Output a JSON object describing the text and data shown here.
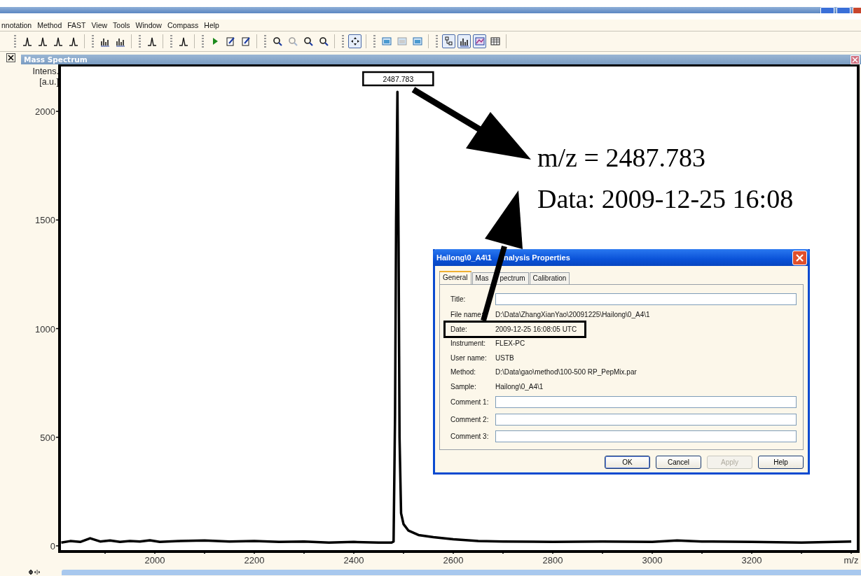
{
  "menu": [
    "nnotation",
    "Method",
    "FAST",
    "View",
    "Tools",
    "Window",
    "Compass",
    "Help"
  ],
  "toolbar": [
    {
      "pressed": false,
      "disabled": false
    },
    {
      "pressed": false,
      "disabled": false
    },
    {
      "pressed": false,
      "disabled": false
    },
    {
      "pressed": false,
      "disabled": false
    },
    {
      "pressed": false,
      "disabled": false
    },
    {
      "pressed": false,
      "disabled": false
    },
    {
      "pressed": false,
      "disabled": false
    },
    {
      "pressed": false,
      "disabled": false
    },
    {
      "pressed": false,
      "disabled": false
    },
    {
      "pressed": false,
      "disabled": false
    },
    {
      "pressed": false,
      "disabled": false
    },
    {
      "pressed": false,
      "disabled": false
    },
    {
      "pressed": false,
      "disabled": true
    },
    {
      "pressed": false,
      "disabled": false
    },
    {
      "pressed": false,
      "disabled": false
    },
    {
      "pressed": true,
      "disabled": false
    },
    {
      "pressed": false,
      "disabled": false
    },
    {
      "pressed": false,
      "disabled": true
    },
    {
      "pressed": false,
      "disabled": false
    },
    {
      "pressed": true,
      "disabled": false
    },
    {
      "pressed": true,
      "disabled": false
    },
    {
      "pressed": true,
      "disabled": false
    },
    {
      "pressed": false,
      "disabled": false
    }
  ],
  "panel": {
    "title": "Mass Spectrum",
    "chart_data": {
      "type": "line",
      "xlabel": "m/z",
      "ylabel": "Intens. [a.u.]",
      "xlim": [
        1808.5,
        3414
      ],
      "ylim": [
        -26,
        2213
      ],
      "xticks": [
        2000,
        2200,
        2400,
        2600,
        2800,
        3000,
        3200
      ],
      "yticks": [
        0,
        500,
        1000,
        1500,
        2000
      ],
      "x": [
        1812,
        1830,
        1850,
        1870,
        1890,
        1910,
        1930,
        1950,
        1970,
        1990,
        2010,
        2050,
        2100,
        2150,
        2200,
        2250,
        2300,
        2350,
        2400,
        2450,
        2476,
        2480,
        2483,
        2485,
        2487.783,
        2490,
        2492,
        2495,
        2500,
        2510,
        2530,
        2560,
        2600,
        2650,
        2700,
        2800,
        2900,
        3000,
        3050,
        3100,
        3200,
        3300,
        3400
      ],
      "series": [
        {
          "color": "#000000",
          "values": [
            15,
            22,
            18,
            35,
            20,
            25,
            18,
            22,
            20,
            26,
            18,
            22,
            25,
            20,
            22,
            18,
            20,
            15,
            18,
            15,
            15,
            20,
            600,
            1500,
            2090,
            1400,
            500,
            150,
            100,
            70,
            50,
            40,
            30,
            22,
            20,
            18,
            20,
            18,
            25,
            20,
            18,
            15,
            20
          ]
        }
      ],
      "annotations": [
        "2487.783"
      ]
    }
  },
  "callout": {
    "lines": [
      "m/z = 2487.783",
      "Data: 2009-12-25 16:08"
    ]
  },
  "dialog": {
    "title": [
      "Hailong\\0_A4\\1",
      "nalysis Properties"
    ],
    "tabs": [
      {
        "label": [
          "General"
        ],
        "selected": true
      },
      {
        "label": [
          "Mas",
          "pectrum"
        ],
        "selected": false
      },
      {
        "label": [
          "Calibration"
        ],
        "selected": false
      }
    ],
    "rows": [
      {
        "kind": "input",
        "label": "Title:",
        "boxed": false
      },
      {
        "kind": "text",
        "label": "File name:",
        "value": "D:\\Data\\ZhangXianYao\\20091225\\Hailong\\0_A4\\1",
        "boxed": false
      },
      {
        "kind": "text",
        "label": "Date:",
        "value": "2009-12-25 16:08:05 UTC",
        "boxed": true
      },
      {
        "kind": "text",
        "label": "Instrument:",
        "value": "FLEX-PC",
        "boxed": false
      },
      {
        "kind": "text",
        "label": "User name:",
        "value": "USTB",
        "boxed": false
      },
      {
        "kind": "text",
        "label": "Method:",
        "value": "D:\\Data\\gao\\method\\100-500 RP_PepMix.par",
        "boxed": false
      },
      {
        "kind": "text",
        "label": "Sample:",
        "value": "Hailong\\0_A4\\1",
        "boxed": false
      },
      {
        "kind": "input",
        "label": "Comment 1:",
        "boxed": false
      },
      {
        "kind": "input",
        "label": "Comment 2:",
        "boxed": false
      },
      {
        "kind": "input",
        "label": "Comment 3:",
        "boxed": false
      }
    ],
    "buttons": [
      {
        "label": "OK",
        "default": true,
        "disabled": false
      },
      {
        "label": "Cancel",
        "default": false,
        "disabled": false
      },
      {
        "label": "Apply",
        "default": false,
        "disabled": true
      },
      {
        "label": "Help",
        "default": false,
        "disabled": false
      }
    ]
  }
}
